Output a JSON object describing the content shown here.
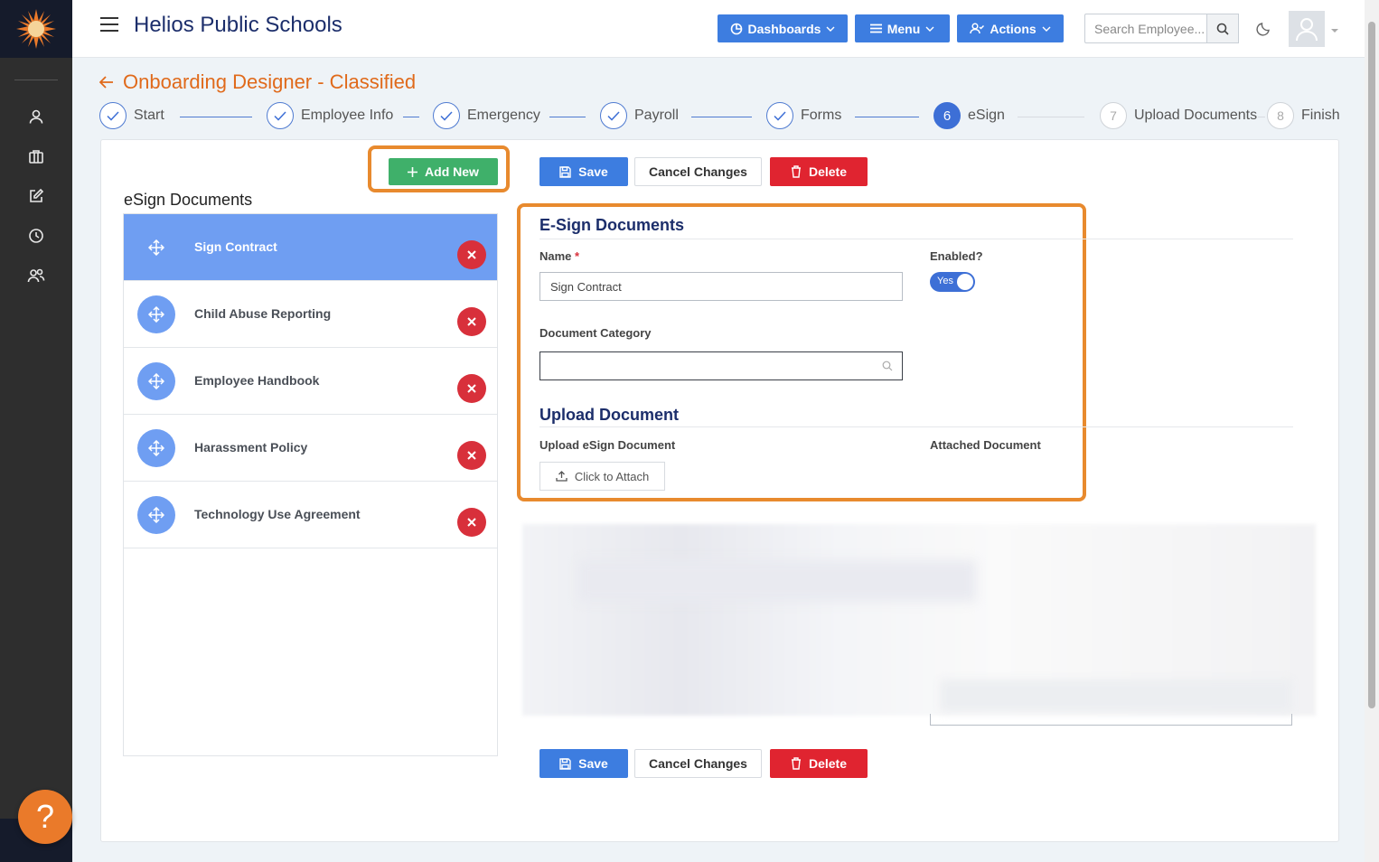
{
  "app": {
    "title": "Helios Public Schools"
  },
  "topbar": {
    "dashboards_label": "Dashboards",
    "menu_label": "Menu",
    "actions_label": "Actions",
    "search_placeholder": "Search Employee..."
  },
  "page": {
    "title": "Onboarding Designer - Classified"
  },
  "steps": [
    {
      "label": "Start",
      "state": "done"
    },
    {
      "label": "Employee Info",
      "state": "done"
    },
    {
      "label": "Emergency",
      "state": "done"
    },
    {
      "label": "Payroll",
      "state": "done"
    },
    {
      "label": "Forms",
      "state": "done"
    },
    {
      "number": "6",
      "label": "eSign",
      "state": "active"
    },
    {
      "number": "7",
      "label": "Upload Documents",
      "state": "todo"
    },
    {
      "number": "8",
      "label": "Finish",
      "state": "todo"
    }
  ],
  "list": {
    "add_new_label": "Add New",
    "heading": "eSign Documents",
    "items": [
      {
        "label": "Sign Contract",
        "selected": true
      },
      {
        "label": "Child Abuse Reporting",
        "selected": false
      },
      {
        "label": "Employee Handbook",
        "selected": false
      },
      {
        "label": "Harassment Policy",
        "selected": false
      },
      {
        "label": "Technology Use Agreement",
        "selected": false
      }
    ]
  },
  "actions": {
    "save_label": "Save",
    "cancel_label": "Cancel Changes",
    "delete_label": "Delete"
  },
  "form": {
    "section_title": "E-Sign Documents",
    "name_label": "Name",
    "name_required_mark": "*",
    "name_value": "Sign Contract",
    "enabled_label": "Enabled?",
    "enabled_value": "Yes",
    "category_label": "Document Category",
    "category_value": "",
    "upload_section_title": "Upload Document",
    "upload_label": "Upload eSign Document",
    "attached_label": "Attached Document",
    "attach_button_label": "Click to Attach"
  },
  "help": {
    "label": "?"
  },
  "colors": {
    "primary": "#3d7de0",
    "accent_orange": "#e06a1b",
    "highlight_orange": "#e88a2e",
    "success": "#3fb06a",
    "danger": "#e02430",
    "title_navy": "#1c2e6b"
  }
}
